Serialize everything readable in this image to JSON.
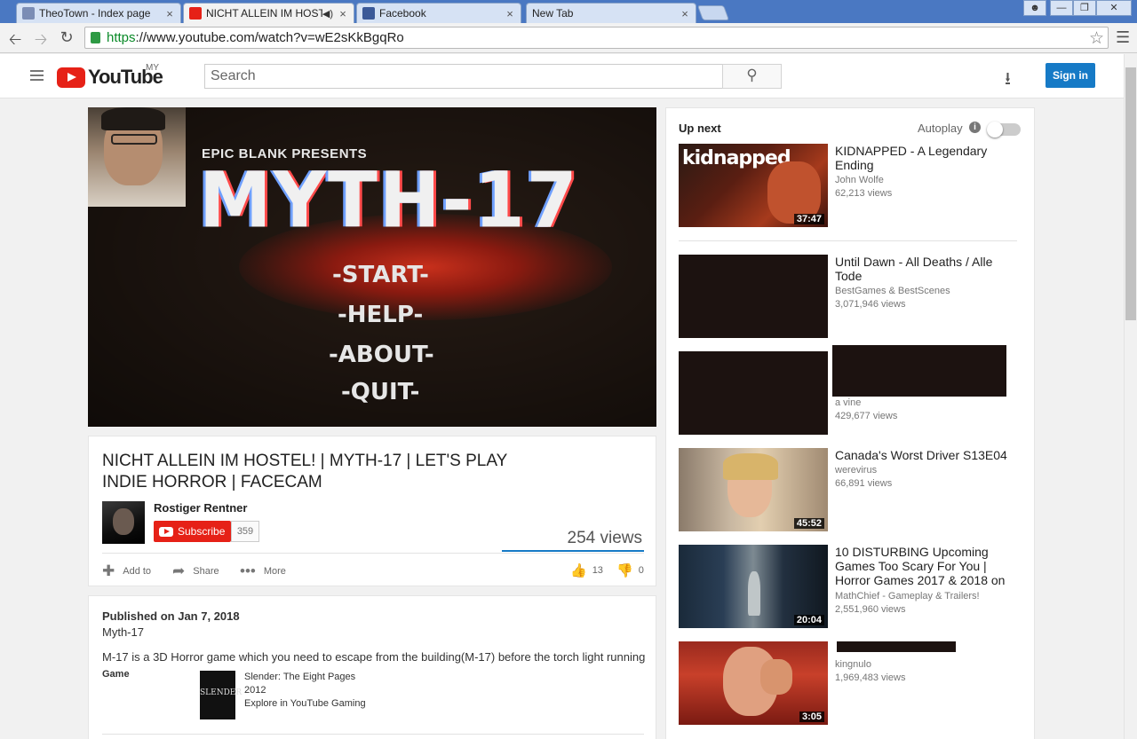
{
  "browser": {
    "tabs": [
      {
        "title": "TheoTown - Index page",
        "close": "×",
        "favicon_color": "#7b8db5"
      },
      {
        "title": "NICHT ALLEIN IM HOSTEL",
        "close": "×",
        "audio": "◀)",
        "favicon_color": "#e62117"
      },
      {
        "title": "Facebook",
        "close": "×",
        "favicon_color": "#3b5998"
      },
      {
        "title": "New Tab",
        "close": "×"
      }
    ],
    "url_scheme": "https",
    "url_rest": "://www.youtube.com/watch?v=wE2sKkBgqRo"
  },
  "masthead": {
    "logo_text": "YouTube",
    "country": "MY",
    "search_placeholder": "Search",
    "sign_in": "Sign in"
  },
  "player": {
    "presents": "EPIC BLANK PRESENTS",
    "game_title": "MYTH-17",
    "menu": [
      "-START-",
      "-HELP-",
      "-ABOUT-",
      "-QUIT-"
    ]
  },
  "video": {
    "title": "NICHT ALLEIN IM HOSTEL! | MYTH-17 | LET'S PLAY INDIE HORROR | FACECAM",
    "channel": "Rostiger Rentner",
    "subscribe_label": "Subscribe",
    "subscriber_count": "359",
    "views": "254 views",
    "actions": {
      "add_to": "Add to",
      "share": "Share",
      "more": "More"
    },
    "likes": "13",
    "dislikes": "0"
  },
  "description": {
    "published": "Published on Jan 7, 2018",
    "line1": "Myth-17",
    "line2": "M-17 is a 3D Horror game which you need to escape from the building(M-17) before the torch light running",
    "game_label": "Game",
    "game_thumb_text": "SLENDER",
    "game_name": "Slender: The Eight Pages",
    "game_year": "2012",
    "game_link": "Explore in YouTube Gaming"
  },
  "sidebar": {
    "up_next": "Up next",
    "autoplay": "Autoplay",
    "recommendations": [
      {
        "title": "KIDNAPPED - A Legendary Ending",
        "channel": "John Wolfe",
        "views": "62,213 views",
        "duration": "37:47",
        "thumb_text": "kidnapped"
      },
      {
        "title": "Until Dawn - All Deaths / Alle Tode",
        "channel": "BestGames & BestScenes",
        "views": "3,071,946 views",
        "duration": ""
      },
      {
        "title": "",
        "channel": "a vine",
        "views": "429,677 views",
        "duration": ""
      },
      {
        "title": "Canada's Worst Driver S13E04",
        "channel": "werevirus",
        "views": "66,891 views",
        "duration": "45:52"
      },
      {
        "title": "10 DISTURBING Upcoming Games Too Scary For You | Horror Games 2017 & 2018 on",
        "channel": "MathChief - Gameplay & Trailers!",
        "views": "2,551,960 views",
        "duration": "20:04"
      },
      {
        "title": "",
        "channel": "kingnulo",
        "views": "1,969,483 views",
        "duration": "3:05"
      }
    ]
  }
}
